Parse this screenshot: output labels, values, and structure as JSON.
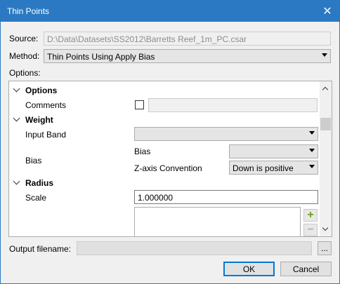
{
  "window": {
    "title": "Thin Points"
  },
  "source": {
    "label": "Source:",
    "value": "D:\\Data\\Datasets\\SS2012\\Barretts Reef_1m_PC.csar"
  },
  "method": {
    "label": "Method:",
    "value": "Thin Points Using Apply Bias"
  },
  "options": {
    "label": "Options:",
    "sections": {
      "options": "Options",
      "weight": "Weight",
      "radius": "Radius"
    },
    "comments_label": "Comments",
    "comments_checked": false,
    "comments_value": "",
    "input_band_label": "Input Band",
    "input_band_value": "",
    "bias_label": "Bias",
    "bias_sub_label": "Bias",
    "bias_value": "",
    "zaxis_label": "Z-axis Convention",
    "zaxis_value": "Down is positive",
    "scale_label": "Scale",
    "scale_value": "1.000000"
  },
  "output": {
    "label": "Output filename:",
    "value": "",
    "browse_label": "..."
  },
  "buttons": {
    "ok": "OK",
    "cancel": "Cancel"
  },
  "colors": {
    "title_bar": "#2b79c2",
    "add_icon": "#6aa121"
  },
  "icons": {
    "close": "close-icon",
    "add": "plus-icon",
    "remove": "minus-icon"
  }
}
